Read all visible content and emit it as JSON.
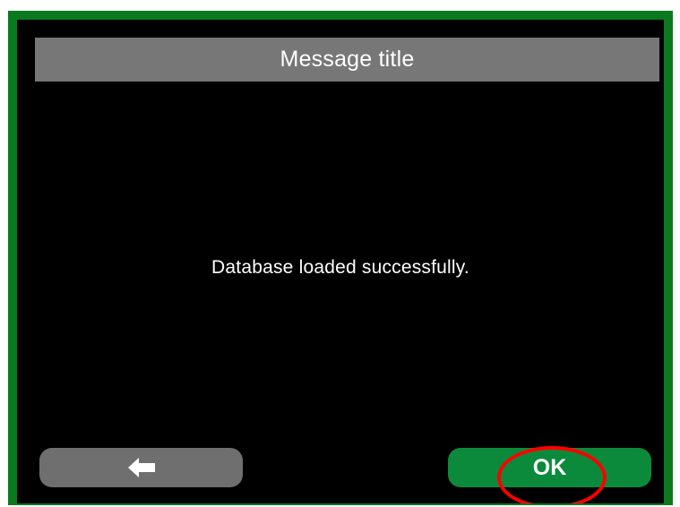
{
  "dialog": {
    "title": "Message title",
    "message": "Database loaded successfully."
  },
  "buttons": {
    "back_icon": "arrow-left-icon",
    "ok_label": "OK"
  },
  "colors": {
    "frame": "#0b7a1e",
    "screen": "#000000",
    "title_bar": "#777777",
    "back_button": "#6f6f6f",
    "ok_button": "#0c8a3c",
    "highlight": "#ff0000"
  }
}
